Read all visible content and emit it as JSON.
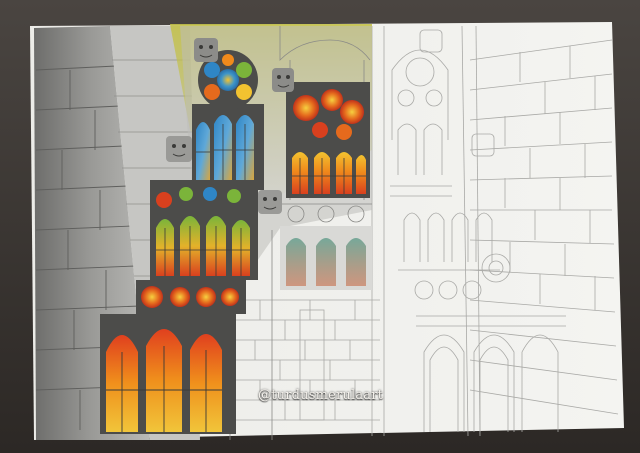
{
  "artwork": {
    "subject": "gothic-cathedral-interior-with-stained-glass",
    "medium": "watercolor-and-pencil-on-paper",
    "state": "partially-painted"
  },
  "watermark": {
    "text": "@turdusmerulaart"
  },
  "colors": {
    "table": "#3a3633",
    "paper": "#efefec",
    "stone_dark": "#7b7b79",
    "stone_light": "#c9c9c6",
    "pencil": "#a8a8a6",
    "glass_red": "#d9401e",
    "glass_orange": "#f08a1c",
    "glass_yellow": "#f2c230",
    "glass_blue": "#2f86c6",
    "glass_green": "#7bb43a",
    "wash_yellow": "#c9c955"
  },
  "icons": [
    "stained-glass-window-icon",
    "rose-window-icon",
    "gargoyle-icon"
  ]
}
